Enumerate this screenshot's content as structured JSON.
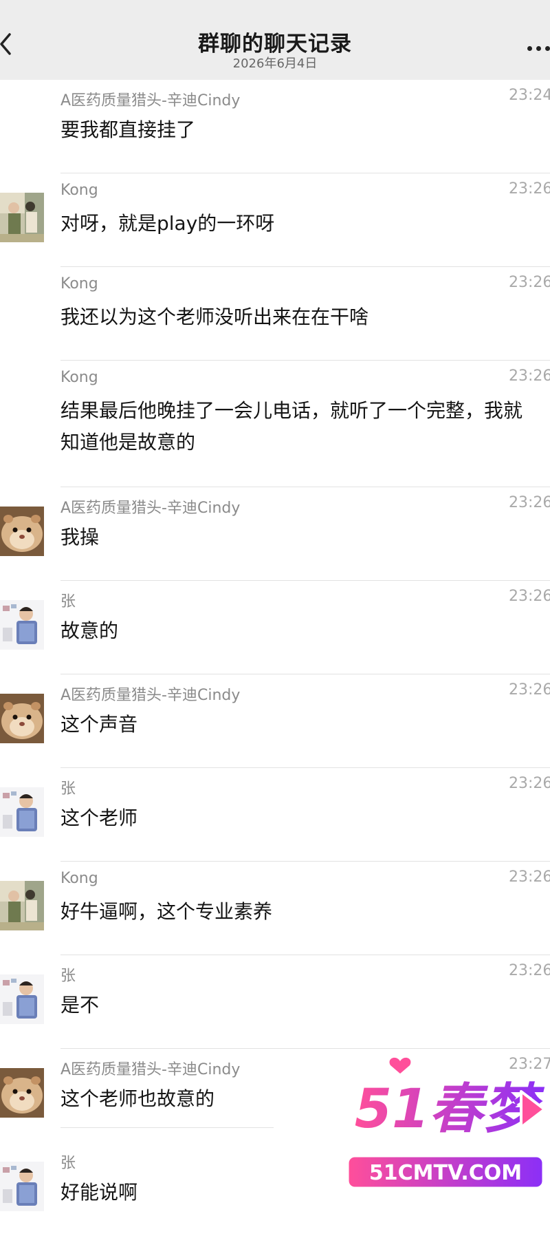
{
  "header": {
    "title": "群聊的聊天记录",
    "date": "2026年6月4日",
    "back_icon": "chevron-left-icon",
    "more_icon": "more-dots-icon"
  },
  "messages": [
    {
      "sender": "A医药质量猎头-辛迪Cindy",
      "time": "23:24",
      "text": "要我都直接挂了",
      "avatar": "none"
    },
    {
      "sender": "Kong",
      "time": "23:26",
      "text": "对呀，就是play的一环呀",
      "avatar": "kong"
    },
    {
      "sender": "Kong",
      "time": "23:26",
      "text": "我还以为这个老师没听出来在在干啥",
      "avatar": "none"
    },
    {
      "sender": "Kong",
      "time": "23:26",
      "text": "结果最后他晚挂了一会儿电话，就听了一个完整，我就知道他是故意的",
      "avatar": "none"
    },
    {
      "sender": "A医药质量猎头-辛迪Cindy",
      "time": "23:26",
      "text": "我操",
      "avatar": "hamster"
    },
    {
      "sender": "张",
      "time": "23:26",
      "text": "故意的",
      "avatar": "boy"
    },
    {
      "sender": "A医药质量猎头-辛迪Cindy",
      "time": "23:26",
      "text": "这个声音",
      "avatar": "hamster"
    },
    {
      "sender": "张",
      "time": "23:26",
      "text": "这个老师",
      "avatar": "boy"
    },
    {
      "sender": "Kong",
      "time": "23:26",
      "text": "好牛逼啊，这个专业素养",
      "avatar": "kong"
    },
    {
      "sender": "张",
      "time": "23:26",
      "text": "是不",
      "avatar": "boy"
    },
    {
      "sender": "A医药质量猎头-辛迪Cindy",
      "time": "23:27",
      "text": "这个老师也故意的",
      "avatar": "hamster"
    },
    {
      "sender": "张",
      "time": "",
      "text": "好能说啊",
      "avatar": "boy"
    }
  ],
  "watermark": {
    "logo_text": "51春梦",
    "site_text": "51CMTV.COM"
  },
  "colors": {
    "header_bg": "#ededed",
    "sender": "#8b8b8b",
    "time": "#a9a9a9",
    "separator": "#e2e2e2",
    "watermark_pink": "#e8318a",
    "watermark_purple": "#7b2ff7"
  }
}
